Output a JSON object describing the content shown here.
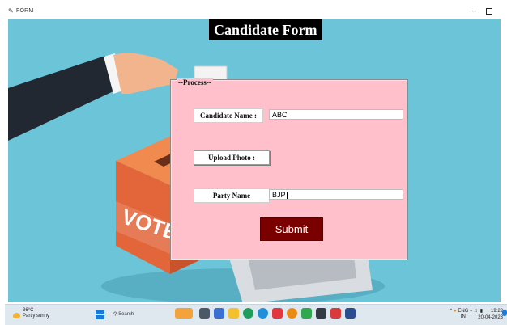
{
  "window": {
    "title": "FORM",
    "minimize_glyph": "–"
  },
  "form": {
    "heading": "Candidate Form",
    "section_legend": "--Process--",
    "candidate_name_label": "Candidate Name :",
    "candidate_name_value": "ABC",
    "upload_photo_label": "Upload Photo :",
    "party_name_label": "Party Name",
    "party_name_value": "BJP",
    "submit_label": "Submit"
  },
  "illustration": {
    "ballot_box_text": "VOTE"
  },
  "taskbar": {
    "weather_temp": "36°C",
    "weather_desc": "Partly sunny",
    "search_label": "Search",
    "language_primary": "ENG",
    "language_secondary": "IN",
    "time": "19:22",
    "date": "20-04-2023"
  },
  "colors": {
    "background": "#6cc4d9",
    "panel": "#ffc0cb",
    "submit": "#7a0000",
    "heading_bg": "#000000"
  }
}
